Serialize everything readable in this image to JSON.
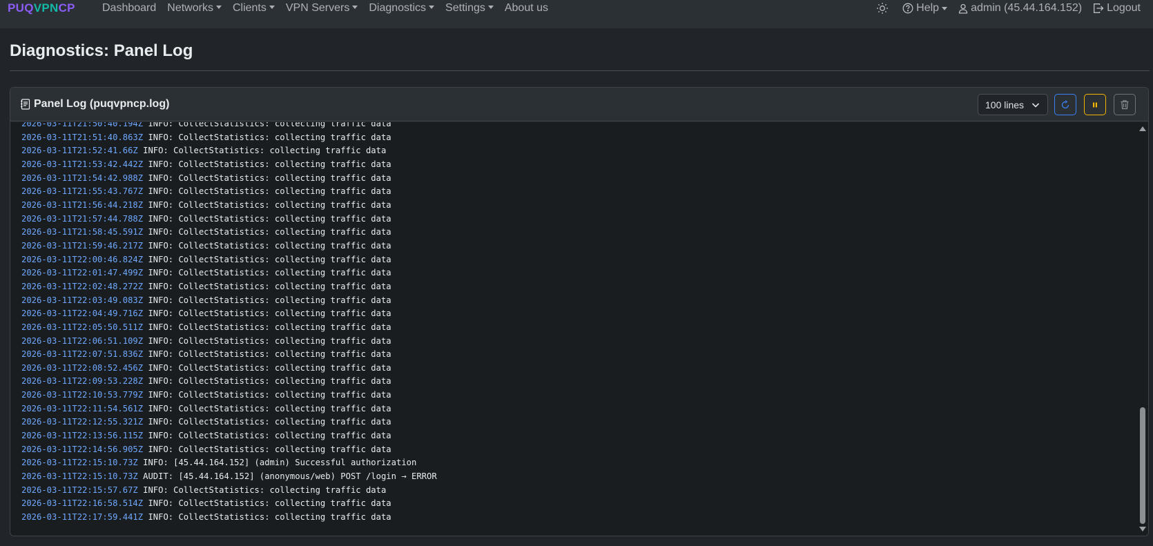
{
  "brand": {
    "part1": "PUQ",
    "part2": "VPN",
    "part3": "CP"
  },
  "nav": {
    "dashboard": "Dashboard",
    "networks": "Networks",
    "clients": "Clients",
    "vpn_servers": "VPN Servers",
    "diagnostics": "Diagnostics",
    "settings": "Settings",
    "about": "About us",
    "help": "Help",
    "user": "admin (45.44.164.152)",
    "logout": "Logout"
  },
  "page": {
    "title": "Diagnostics: Panel Log"
  },
  "card": {
    "title": "Panel Log (puqvpncp.log)",
    "lines_select": "100 lines"
  },
  "colors": {
    "accent_blue": "#3b82f6",
    "warning_yellow": "#f5b400",
    "timestamp": "#6ea8fe",
    "brand_purple": "#8b5cf6",
    "brand_teal": "#14b8a6"
  },
  "log": {
    "lines": [
      {
        "ts": "2026-03-11T21:50:40.194Z",
        "msg": " INFO: CollectStatistics: collecting traffic data"
      },
      {
        "ts": "2026-03-11T21:51:40.863Z",
        "msg": " INFO: CollectStatistics: collecting traffic data"
      },
      {
        "ts": "2026-03-11T21:52:41.66Z",
        "msg": " INFO: CollectStatistics: collecting traffic data"
      },
      {
        "ts": "2026-03-11T21:53:42.442Z",
        "msg": " INFO: CollectStatistics: collecting traffic data"
      },
      {
        "ts": "2026-03-11T21:54:42.988Z",
        "msg": " INFO: CollectStatistics: collecting traffic data"
      },
      {
        "ts": "2026-03-11T21:55:43.767Z",
        "msg": " INFO: CollectStatistics: collecting traffic data"
      },
      {
        "ts": "2026-03-11T21:56:44.218Z",
        "msg": " INFO: CollectStatistics: collecting traffic data"
      },
      {
        "ts": "2026-03-11T21:57:44.788Z",
        "msg": " INFO: CollectStatistics: collecting traffic data"
      },
      {
        "ts": "2026-03-11T21:58:45.591Z",
        "msg": " INFO: CollectStatistics: collecting traffic data"
      },
      {
        "ts": "2026-03-11T21:59:46.217Z",
        "msg": " INFO: CollectStatistics: collecting traffic data"
      },
      {
        "ts": "2026-03-11T22:00:46.824Z",
        "msg": " INFO: CollectStatistics: collecting traffic data"
      },
      {
        "ts": "2026-03-11T22:01:47.499Z",
        "msg": " INFO: CollectStatistics: collecting traffic data"
      },
      {
        "ts": "2026-03-11T22:02:48.272Z",
        "msg": " INFO: CollectStatistics: collecting traffic data"
      },
      {
        "ts": "2026-03-11T22:03:49.083Z",
        "msg": " INFO: CollectStatistics: collecting traffic data"
      },
      {
        "ts": "2026-03-11T22:04:49.716Z",
        "msg": " INFO: CollectStatistics: collecting traffic data"
      },
      {
        "ts": "2026-03-11T22:05:50.511Z",
        "msg": " INFO: CollectStatistics: collecting traffic data"
      },
      {
        "ts": "2026-03-11T22:06:51.109Z",
        "msg": " INFO: CollectStatistics: collecting traffic data"
      },
      {
        "ts": "2026-03-11T22:07:51.836Z",
        "msg": " INFO: CollectStatistics: collecting traffic data"
      },
      {
        "ts": "2026-03-11T22:08:52.456Z",
        "msg": " INFO: CollectStatistics: collecting traffic data"
      },
      {
        "ts": "2026-03-11T22:09:53.228Z",
        "msg": " INFO: CollectStatistics: collecting traffic data"
      },
      {
        "ts": "2026-03-11T22:10:53.779Z",
        "msg": " INFO: CollectStatistics: collecting traffic data"
      },
      {
        "ts": "2026-03-11T22:11:54.561Z",
        "msg": " INFO: CollectStatistics: collecting traffic data"
      },
      {
        "ts": "2026-03-11T22:12:55.321Z",
        "msg": " INFO: CollectStatistics: collecting traffic data"
      },
      {
        "ts": "2026-03-11T22:13:56.115Z",
        "msg": " INFO: CollectStatistics: collecting traffic data"
      },
      {
        "ts": "2026-03-11T22:14:56.905Z",
        "msg": " INFO: CollectStatistics: collecting traffic data"
      },
      {
        "ts": "2026-03-11T22:15:10.73Z",
        "msg": " INFO: [45.44.164.152] (admin) Successful authorization"
      },
      {
        "ts": "2026-03-11T22:15:10.73Z",
        "msg": " AUDIT: [45.44.164.152] (anonymous/web) POST /login → ERROR"
      },
      {
        "ts": "2026-03-11T22:15:57.67Z",
        "msg": " INFO: CollectStatistics: collecting traffic data"
      },
      {
        "ts": "2026-03-11T22:16:58.514Z",
        "msg": " INFO: CollectStatistics: collecting traffic data"
      },
      {
        "ts": "2026-03-11T22:17:59.441Z",
        "msg": " INFO: CollectStatistics: collecting traffic data"
      }
    ]
  }
}
